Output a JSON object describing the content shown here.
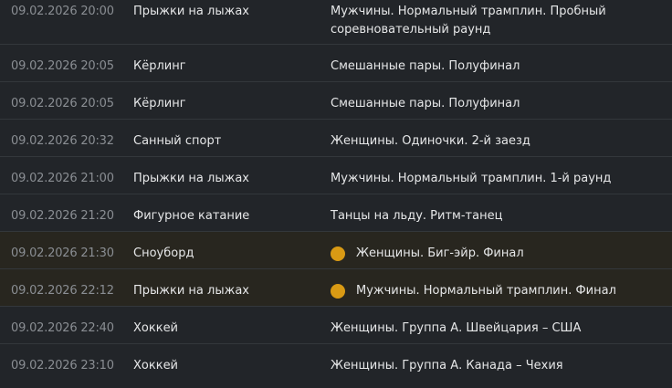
{
  "rows": [
    {
      "time": "09.02.2026 20:00",
      "sport": "Прыжки на лыжах",
      "event": "Мужчины. Нормальный трамплин. Пробный соревновательный раунд",
      "medal": false
    },
    {
      "time": "09.02.2026 20:05",
      "sport": "Кёрлинг",
      "event": "Смешанные пары. Полуфинал",
      "medal": false
    },
    {
      "time": "09.02.2026 20:05",
      "sport": "Кёрлинг",
      "event": "Смешанные пары. Полуфинал",
      "medal": false
    },
    {
      "time": "09.02.2026 20:32",
      "sport": "Санный спорт",
      "event": "Женщины. Одиночки. 2-й заезд",
      "medal": false
    },
    {
      "time": "09.02.2026 21:00",
      "sport": "Прыжки на лыжах",
      "event": "Мужчины. Нормальный трамплин. 1-й раунд",
      "medal": false
    },
    {
      "time": "09.02.2026 21:20",
      "sport": "Фигурное катание",
      "event": "Танцы на льду. Ритм-танец",
      "medal": false
    },
    {
      "time": "09.02.2026 21:30",
      "sport": "Сноуборд",
      "event": "Женщины. Биг-эйр. Финал",
      "medal": true
    },
    {
      "time": "09.02.2026 22:12",
      "sport": "Прыжки на лыжах",
      "event": "Мужчины. Нормальный трамплин. Финал",
      "medal": true
    },
    {
      "time": "09.02.2026 22:40",
      "sport": "Хоккей",
      "event": "Женщины. Группа А. Швейцария – США",
      "medal": false
    },
    {
      "time": "09.02.2026 23:10",
      "sport": "Хоккей",
      "event": "Женщины. Группа А. Канада – Чехия",
      "medal": false
    }
  ],
  "colors": {
    "background": "#222529",
    "medal_row_background": "#28261f",
    "medal_icon": "#d99a14",
    "time_text": "#8a8e93",
    "primary_text": "#e6e7e8"
  }
}
